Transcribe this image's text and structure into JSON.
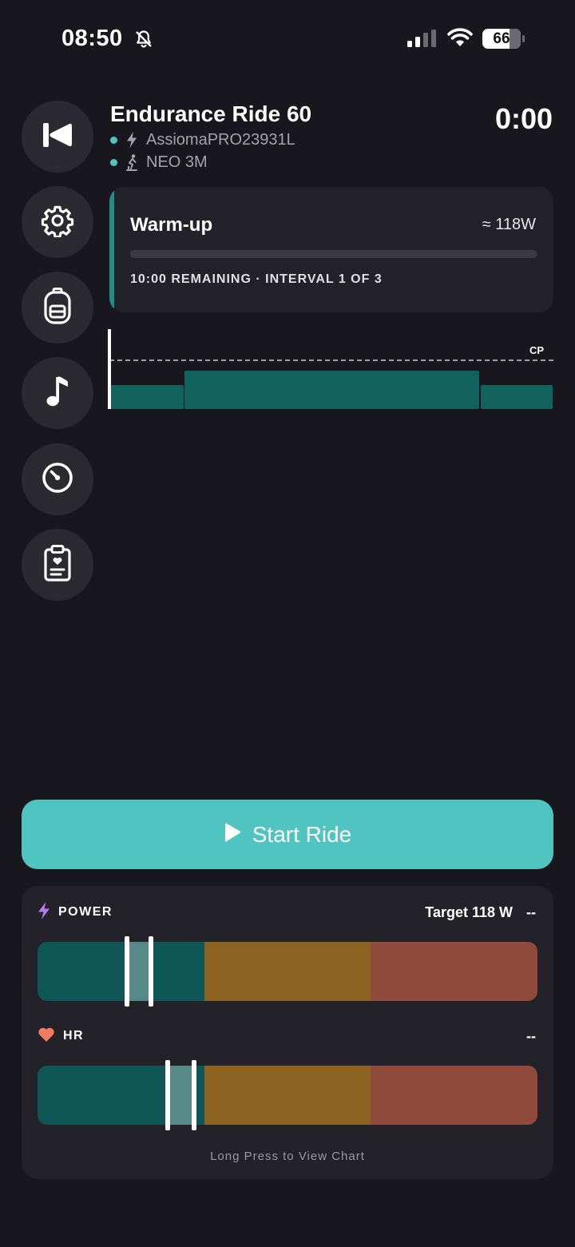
{
  "status_bar": {
    "time": "08:50",
    "battery": "66"
  },
  "sidebar": {
    "items": [
      {
        "icon": "skip-back-icon"
      },
      {
        "icon": "gear-icon"
      },
      {
        "icon": "backpack-icon"
      },
      {
        "icon": "music-note-icon"
      },
      {
        "icon": "gauge-icon"
      },
      {
        "icon": "clipboard-heart-icon"
      }
    ]
  },
  "workout": {
    "title": "Endurance Ride 60",
    "elapsed": "0:00",
    "devices": [
      {
        "icon": "bolt-icon",
        "name": "AssiomaPRO23931L"
      },
      {
        "icon": "bike-trainer-icon",
        "name": "NEO 3M"
      }
    ]
  },
  "interval": {
    "name": "Warm-up",
    "target": "≈ 118W",
    "meta": "10:00 REMAINING · INTERVAL 1 OF 3",
    "progress": 0
  },
  "profile": {
    "cp_label": "CP"
  },
  "actions": {
    "start_label": "Start Ride"
  },
  "metrics": {
    "power": {
      "label": "POWER",
      "target": "Target 118 W",
      "value": "--"
    },
    "hr": {
      "label": "HR",
      "value": "--"
    },
    "hint": "Long Press to View Chart"
  },
  "colors": {
    "accent": "#4fc4c1",
    "zone_1": "#0f5756",
    "zone_2": "#8b621f",
    "zone_3": "#8f4a3c",
    "profile_block": "#12625f"
  }
}
